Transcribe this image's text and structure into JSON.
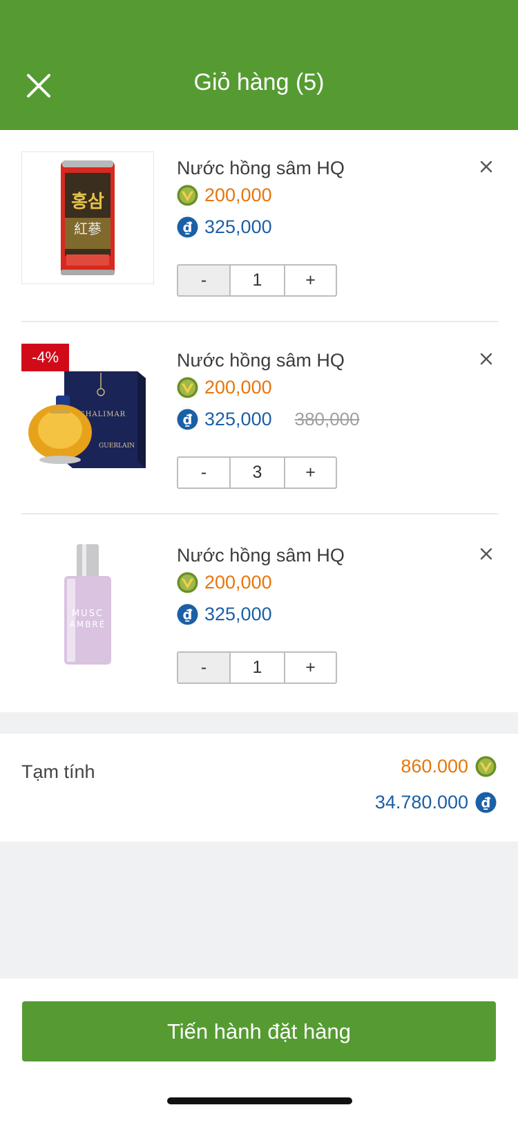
{
  "header": {
    "title": "Giỏ hàng (5)"
  },
  "items": [
    {
      "name": "Nước hồng sâm HQ",
      "price_points": "200,000",
      "price_vnd": "325,000",
      "old_price": "",
      "badge": "",
      "qty": "1"
    },
    {
      "name": "Nước hồng sâm HQ",
      "price_points": "200,000",
      "price_vnd": "325,000",
      "old_price": "380,000",
      "badge": "-4%",
      "qty": "3"
    },
    {
      "name": "Nước hồng sâm HQ",
      "price_points": "200,000",
      "price_vnd": "325,000",
      "old_price": "",
      "badge": "",
      "qty": "1"
    }
  ],
  "products": {
    "ginseng_text": "홍삼",
    "ginseng_text_2": "紅蔘",
    "perfume_box_brand": "SHALIMAR",
    "perfume_box_maker": "GUERLAIN",
    "musc_line_1": "MUSC",
    "musc_line_2": "AMBRÉ"
  },
  "subtotal": {
    "label": "Tạm tính",
    "points": "860.000",
    "vnd": "34.780.000"
  },
  "qty_controls": {
    "minus": "-",
    "plus": "+"
  },
  "cta": {
    "label": "Tiến hành đặt hàng"
  },
  "icons": {
    "close": "close-icon",
    "remove": "remove-icon",
    "points_coin": "v-coin-icon",
    "dong": "dong-icon"
  },
  "colors": {
    "brand_green": "#559b32",
    "points_orange": "#e8750b",
    "vnd_blue": "#1b5fa6",
    "badge_red": "#d10a1a"
  }
}
